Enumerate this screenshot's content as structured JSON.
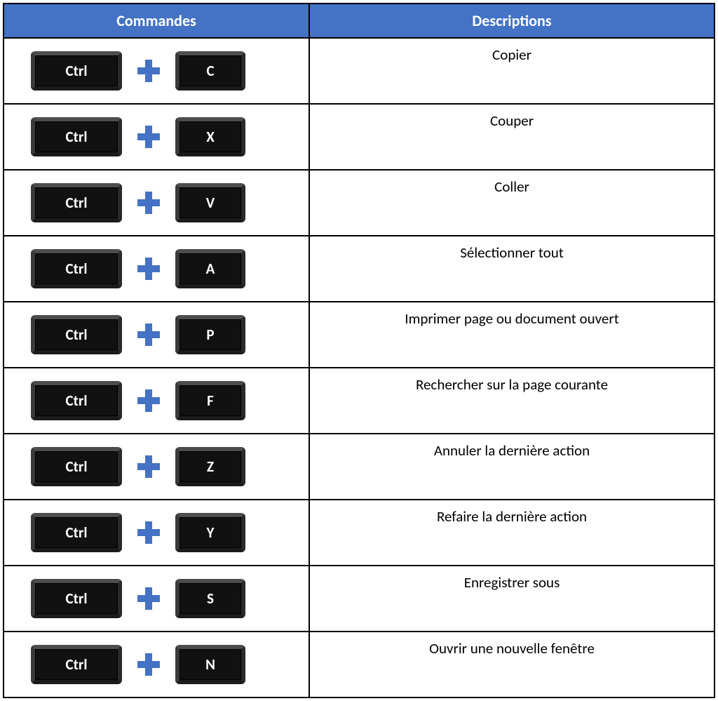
{
  "headers": {
    "commands": "Commandes",
    "descriptions": "Descriptions"
  },
  "rows": [
    {
      "modifier": "Ctrl",
      "key": "C",
      "description": "Copier"
    },
    {
      "modifier": "Ctrl",
      "key": "X",
      "description": "Couper"
    },
    {
      "modifier": "Ctrl",
      "key": "V",
      "description": "Coller"
    },
    {
      "modifier": "Ctrl",
      "key": "A",
      "description": "Sélectionner tout"
    },
    {
      "modifier": "Ctrl",
      "key": "P",
      "description": "Imprimer page ou document ouvert"
    },
    {
      "modifier": "Ctrl",
      "key": "F",
      "description": "Rechercher sur la page courante"
    },
    {
      "modifier": "Ctrl",
      "key": "Z",
      "description": "Annuler la dernière action"
    },
    {
      "modifier": "Ctrl",
      "key": "Y",
      "description": "Refaire la dernière action"
    },
    {
      "modifier": "Ctrl",
      "key": "S",
      "description": "Enregistrer sous"
    },
    {
      "modifier": "Ctrl",
      "key": "N",
      "description": "Ouvrir une nouvelle fenêtre"
    }
  ]
}
